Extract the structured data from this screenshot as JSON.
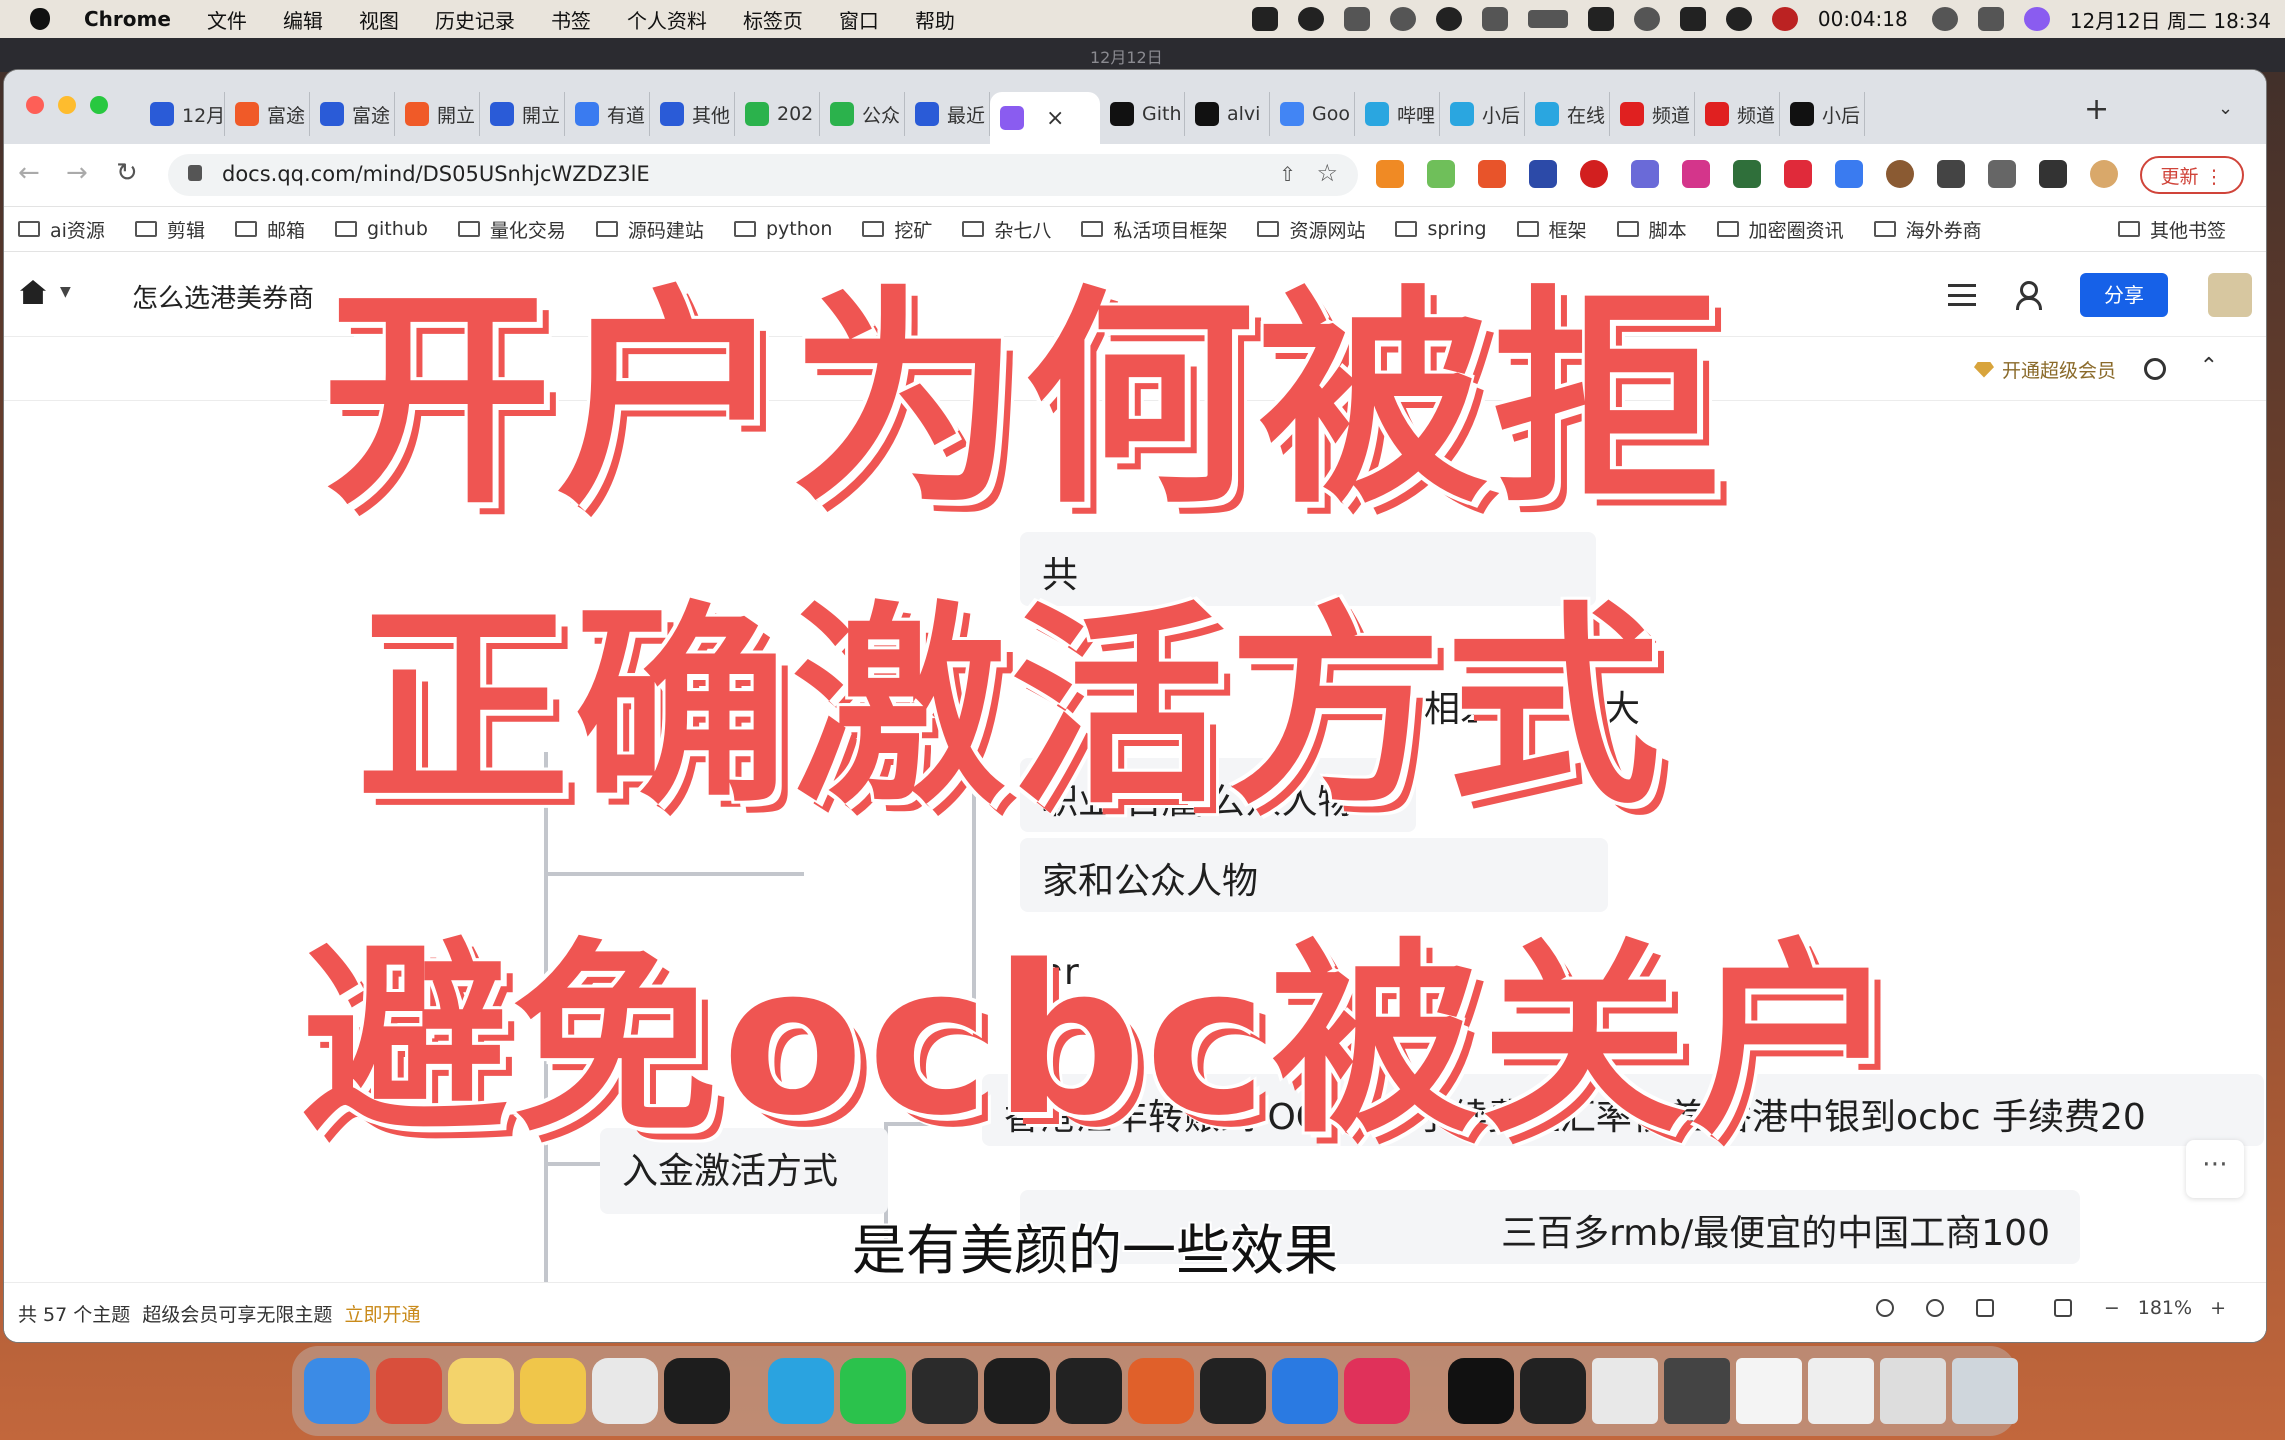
{
  "menubar": {
    "app": "Chrome",
    "items": [
      "文件",
      "编辑",
      "视图",
      "历史记录",
      "书签",
      "个人资料",
      "标签页",
      "窗口",
      "帮助"
    ],
    "timer": "00:04:18",
    "datetime": "12月12日 周二  18:34"
  },
  "background_window": {
    "title": "12月12日"
  },
  "tabs": [
    {
      "label": "12月",
      "color": "#2a5bd7",
      "icon": "doc-icon"
    },
    {
      "label": "富途",
      "color": "#f05a28",
      "icon": "futu-icon"
    },
    {
      "label": "富途",
      "color": "#2a5bd7",
      "icon": "doc-icon"
    },
    {
      "label": "開立",
      "color": "#f05a28",
      "icon": "futu-icon"
    },
    {
      "label": "開立",
      "color": "#2a5bd7",
      "icon": "doc-icon"
    },
    {
      "label": "有道",
      "color": "#3a7bf0",
      "icon": "edit-icon"
    },
    {
      "label": "其他",
      "color": "#2a5bd7",
      "icon": "doc-icon"
    },
    {
      "label": "202",
      "color": "#2bb24c",
      "icon": "chat-icon"
    },
    {
      "label": "公众",
      "color": "#2bb24c",
      "icon": "refresh-icon"
    },
    {
      "label": "最近",
      "color": "#2a5bd7",
      "icon": "flag-icon"
    },
    {
      "label": "",
      "color": "#8a5cf0",
      "icon": "mindmap-icon",
      "active": true
    },
    {
      "label": "Gith",
      "color": "#111111",
      "icon": "github-icon"
    },
    {
      "label": "alvi",
      "color": "#111111",
      "icon": "github-icon"
    },
    {
      "label": "Goo",
      "color": "#4285f4",
      "icon": "google-icon"
    },
    {
      "label": "哔哩",
      "color": "#2aa6e0",
      "icon": "bilibili-icon"
    },
    {
      "label": "小后",
      "color": "#2aa6e0",
      "icon": "bilibili-icon"
    },
    {
      "label": "在线",
      "color": "#2aa6e0",
      "icon": "bilibili-icon"
    },
    {
      "label": "频道",
      "color": "#e02020",
      "icon": "youtube-icon"
    },
    {
      "label": "频道",
      "color": "#e02020",
      "icon": "youtube-icon"
    },
    {
      "label": "小后",
      "color": "#111111",
      "icon": "x-icon"
    }
  ],
  "toolbar": {
    "url": "docs.qq.com/mind/DS05USnhjcWZDZ3lE",
    "update_label": "更新"
  },
  "bookmarks": [
    "ai资源",
    "剪辑",
    "邮箱",
    "github",
    "量化交易",
    "源码建站",
    "python",
    "挖矿",
    "杂七八",
    "私活项目框架",
    "资源网站",
    "spring",
    "框架",
    "脚本",
    "加密圈资讯",
    "海外券商"
  ],
  "bookmarks_other": "其他书签",
  "doc": {
    "title": "怎么选港美券商",
    "share_label": "分享",
    "vip_label": "开通超级会员"
  },
  "mindmap": {
    "nodes": [
      "共",
      "相差",
      "大",
      "职业 自雇/公众人物",
      "家和公众人物",
      "ar",
      "香港汇丰转账到 OCBC 0 手续费但汇率很差/香港中银到ocbc 手续费20",
      "入金激活方式",
      "三百多rmb/最便宜的中国工商100"
    ]
  },
  "status": {
    "topics": "共 57 个主题",
    "promo": "超级会员可享无限主题",
    "link": "立即开通",
    "zoom": "181%"
  },
  "overlay": {
    "line1": "开户为何被拒",
    "line2": "正确激活方式",
    "line3": "避免ocbc被关户",
    "subtitle": "是有美颜的一些效果"
  },
  "dock": {
    "icons": [
      "finder-icon",
      "launchpad-icon",
      "notes-icon",
      "neat-icon",
      "chrome-icon",
      "webstorm-icon",
      "telegram-icon",
      "wechat-icon",
      "pycharm-icon",
      "intellij-icon",
      "terminal-icon",
      "pencil-icon",
      "figma-icon",
      "keynote-icon",
      "pdf-icon",
      "capcut-icon",
      "recorder-icon"
    ],
    "colors": [
      "#3b8be6",
      "#d94f3c",
      "#f3d36b",
      "#f0c64a",
      "#e8e8e8",
      "#1d1d1d",
      "#2aa3e0",
      "#2bc24c",
      "#2b2b2b",
      "#1d1d1d",
      "#222222",
      "#e0602a",
      "#222222",
      "#2a7ae2",
      "#e0315a",
      "#111111",
      "#222222"
    ]
  }
}
